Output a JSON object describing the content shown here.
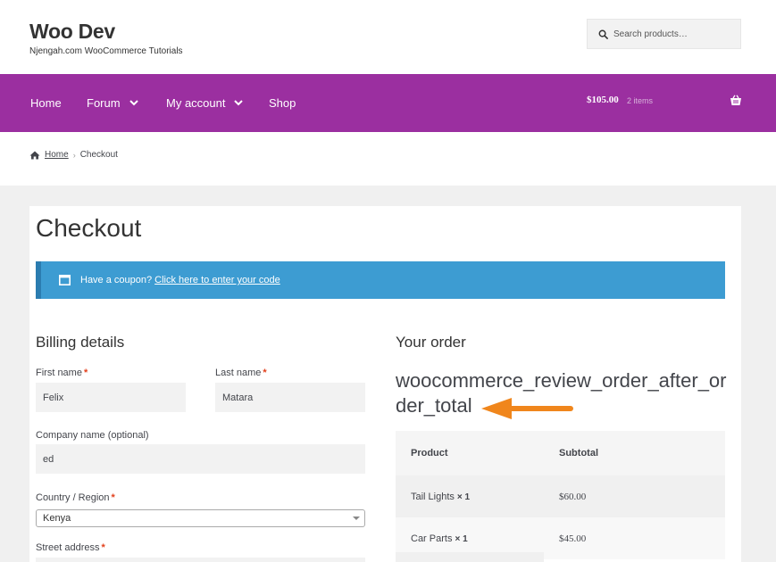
{
  "site": {
    "title": "Woo Dev",
    "description": "Njengah.com WooCommerce Tutorials"
  },
  "search": {
    "placeholder": "Search products…",
    "icon": "search-icon"
  },
  "nav": {
    "items": [
      {
        "label": "Home",
        "has_dropdown": false
      },
      {
        "label": "Forum",
        "has_dropdown": true
      },
      {
        "label": "My account",
        "has_dropdown": true
      },
      {
        "label": "Shop",
        "has_dropdown": false
      }
    ],
    "cart": {
      "amount": "$105.00",
      "count": "2 items",
      "icon": "basket-icon"
    },
    "color": "#9b2fa0"
  },
  "breadcrumb": {
    "home": "Home",
    "separator": "›",
    "current": "Checkout"
  },
  "page": {
    "title": "Checkout"
  },
  "coupon": {
    "text": "Have a coupon?",
    "link": "Click here to enter your code",
    "color": "#3d9cd2"
  },
  "billing": {
    "heading": "Billing details",
    "first_name": {
      "label": "First name",
      "value": "Felix",
      "required": "*"
    },
    "last_name": {
      "label": "Last name",
      "value": "Matara",
      "required": "*"
    },
    "company": {
      "label": "Company name (optional)",
      "value": "ed"
    },
    "country": {
      "label": "Country / Region",
      "value": "Kenya",
      "required": "*"
    },
    "street": {
      "label": "Street address",
      "required": "*"
    }
  },
  "order": {
    "heading": "Your order",
    "hook_text": "woocommerce_review_order_after_order_total",
    "arrow_color": "#f0861c",
    "columns": [
      "Product",
      "Subtotal"
    ],
    "items": [
      {
        "name": "Tail Lights",
        "qty": "× 1",
        "subtotal": "$60.00"
      },
      {
        "name": "Car Parts",
        "qty": "× 1",
        "subtotal": "$45.00"
      }
    ]
  }
}
